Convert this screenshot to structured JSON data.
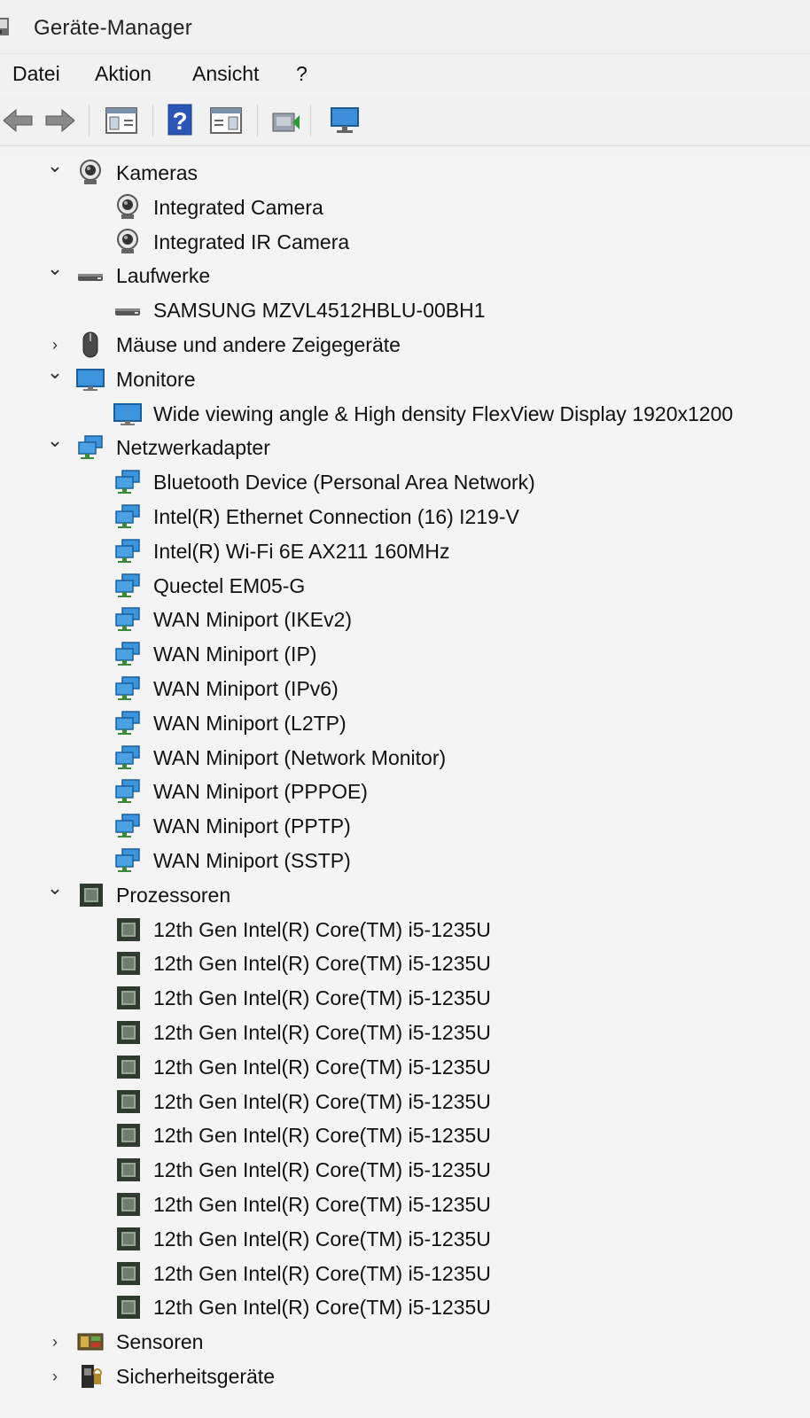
{
  "window": {
    "title": "Geräte-Manager"
  },
  "menu": [
    {
      "label": "Datei"
    },
    {
      "label": "Aktion"
    },
    {
      "label": "Ansicht"
    },
    {
      "label": "?"
    }
  ],
  "toolbar": {
    "buttons": [
      {
        "name": "back-button",
        "icon": "arrow-left-icon"
      },
      {
        "name": "forward-button",
        "icon": "arrow-right-icon"
      },
      {
        "name": "show-hide-console-tree-button",
        "icon": "console-tree-icon"
      },
      {
        "name": "help-button",
        "icon": "help-icon"
      },
      {
        "name": "show-action-pane-button",
        "icon": "action-pane-icon"
      },
      {
        "name": "update-driver-button",
        "icon": "update-driver-icon"
      },
      {
        "name": "scan-hardware-button",
        "icon": "monitor-scan-icon"
      }
    ]
  },
  "tree": [
    {
      "type": "category",
      "label": "Kameras",
      "expanded": true,
      "icon": "camera"
    },
    {
      "type": "device",
      "label": "Integrated Camera",
      "icon": "camera"
    },
    {
      "type": "device",
      "label": "Integrated IR Camera",
      "icon": "camera"
    },
    {
      "type": "category",
      "label": "Laufwerke",
      "expanded": true,
      "icon": "drive"
    },
    {
      "type": "device",
      "label": "SAMSUNG MZVL4512HBLU-00BH1",
      "icon": "drive"
    },
    {
      "type": "category",
      "label": "Mäuse und andere Zeigegeräte",
      "expanded": false,
      "icon": "mouse"
    },
    {
      "type": "category",
      "label": "Monitore",
      "expanded": true,
      "icon": "monitor"
    },
    {
      "type": "device",
      "label": "Wide viewing angle & High density FlexView Display 1920x1200",
      "icon": "monitor"
    },
    {
      "type": "category",
      "label": "Netzwerkadapter",
      "expanded": true,
      "icon": "network"
    },
    {
      "type": "device",
      "label": "Bluetooth Device (Personal Area Network)",
      "icon": "network"
    },
    {
      "type": "device",
      "label": "Intel(R) Ethernet Connection (16) I219-V",
      "icon": "network"
    },
    {
      "type": "device",
      "label": "Intel(R) Wi-Fi 6E AX211 160MHz",
      "icon": "network"
    },
    {
      "type": "device",
      "label": "Quectel EM05-G",
      "icon": "network"
    },
    {
      "type": "device",
      "label": "WAN Miniport (IKEv2)",
      "icon": "network"
    },
    {
      "type": "device",
      "label": "WAN Miniport (IP)",
      "icon": "network"
    },
    {
      "type": "device",
      "label": "WAN Miniport (IPv6)",
      "icon": "network"
    },
    {
      "type": "device",
      "label": "WAN Miniport (L2TP)",
      "icon": "network"
    },
    {
      "type": "device",
      "label": "WAN Miniport (Network Monitor)",
      "icon": "network"
    },
    {
      "type": "device",
      "label": "WAN Miniport (PPPOE)",
      "icon": "network"
    },
    {
      "type": "device",
      "label": "WAN Miniport (PPTP)",
      "icon": "network"
    },
    {
      "type": "device",
      "label": "WAN Miniport (SSTP)",
      "icon": "network"
    },
    {
      "type": "category",
      "label": "Prozessoren",
      "expanded": true,
      "icon": "processor"
    },
    {
      "type": "device",
      "label": "12th Gen Intel(R) Core(TM) i5-1235U",
      "icon": "processor"
    },
    {
      "type": "device",
      "label": "12th Gen Intel(R) Core(TM) i5-1235U",
      "icon": "processor"
    },
    {
      "type": "device",
      "label": "12th Gen Intel(R) Core(TM) i5-1235U",
      "icon": "processor"
    },
    {
      "type": "device",
      "label": "12th Gen Intel(R) Core(TM) i5-1235U",
      "icon": "processor"
    },
    {
      "type": "device",
      "label": "12th Gen Intel(R) Core(TM) i5-1235U",
      "icon": "processor"
    },
    {
      "type": "device",
      "label": "12th Gen Intel(R) Core(TM) i5-1235U",
      "icon": "processor"
    },
    {
      "type": "device",
      "label": "12th Gen Intel(R) Core(TM) i5-1235U",
      "icon": "processor"
    },
    {
      "type": "device",
      "label": "12th Gen Intel(R) Core(TM) i5-1235U",
      "icon": "processor"
    },
    {
      "type": "device",
      "label": "12th Gen Intel(R) Core(TM) i5-1235U",
      "icon": "processor"
    },
    {
      "type": "device",
      "label": "12th Gen Intel(R) Core(TM) i5-1235U",
      "icon": "processor"
    },
    {
      "type": "device",
      "label": "12th Gen Intel(R) Core(TM) i5-1235U",
      "icon": "processor"
    },
    {
      "type": "device",
      "label": "12th Gen Intel(R) Core(TM) i5-1235U",
      "icon": "processor"
    },
    {
      "type": "category",
      "label": "Sensoren",
      "expanded": false,
      "icon": "sensor"
    },
    {
      "type": "category",
      "label": "Sicherheitsgeräte",
      "expanded": false,
      "icon": "security"
    }
  ]
}
